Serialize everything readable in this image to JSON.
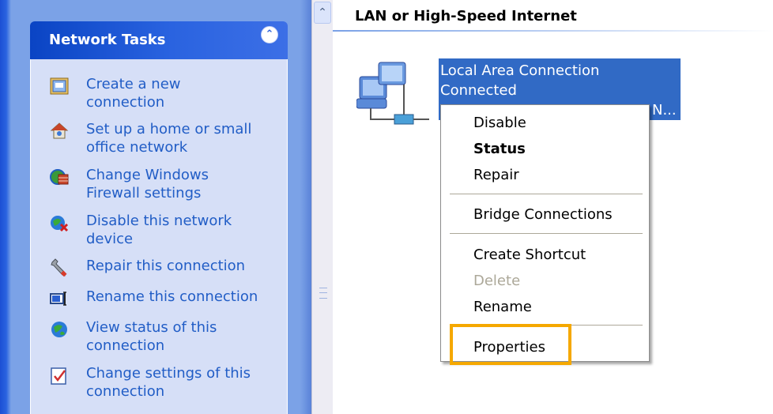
{
  "task_pane": {
    "title": "Network Tasks",
    "collapse_icon": "double-chevron-up-icon",
    "tasks": [
      {
        "line1": "Create a new",
        "line2": "connection",
        "icon": "new-connection-icon"
      },
      {
        "line1": "Set up a home or small",
        "line2": "office network",
        "icon": "home-network-icon"
      },
      {
        "line1": "Change Windows",
        "line2": "Firewall settings",
        "icon": "firewall-icon"
      },
      {
        "line1": "Disable this network",
        "line2": "device",
        "icon": "disable-network-icon"
      },
      {
        "line1": "Repair this connection",
        "line2": "",
        "icon": "repair-wrench-icon"
      },
      {
        "line1": "Rename this connection",
        "line2": "",
        "icon": "rename-icon"
      },
      {
        "line1": "View status of this",
        "line2": "connection",
        "icon": "view-status-icon"
      },
      {
        "line1": "Change settings of this",
        "line2": "connection",
        "icon": "change-settings-icon"
      }
    ]
  },
  "main": {
    "group_title": "LAN or High-Speed Internet",
    "connection": {
      "name": "Local Area Connection",
      "status": "Connected",
      "device_truncated": "N..."
    }
  },
  "context_menu": {
    "items": [
      {
        "label": "Disable",
        "style": "normal"
      },
      {
        "label": "Status",
        "style": "bold"
      },
      {
        "label": "Repair",
        "style": "normal"
      },
      {
        "label": "Bridge Connections",
        "style": "normal"
      },
      {
        "label": "Create Shortcut",
        "style": "normal"
      },
      {
        "label": "Delete",
        "style": "disabled"
      },
      {
        "label": "Rename",
        "style": "normal"
      },
      {
        "label": "Properties",
        "style": "normal"
      }
    ],
    "highlighted_item": "Properties"
  },
  "colors": {
    "task_link": "#215dc6",
    "task_pane_bg": "#d6dff7",
    "selection": "#316ac5",
    "highlight_box": "#f5a800"
  }
}
